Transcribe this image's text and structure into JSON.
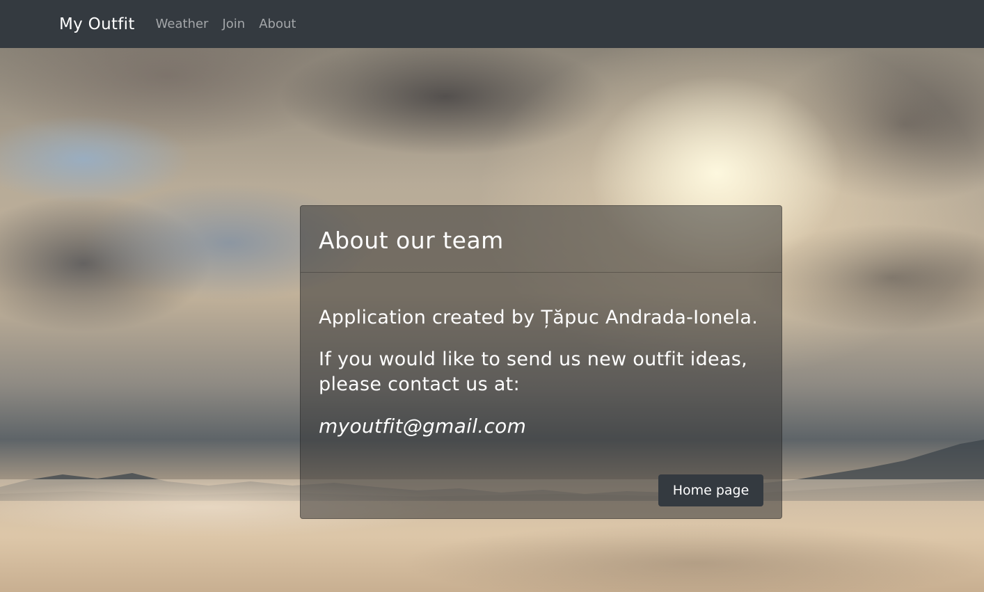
{
  "navbar": {
    "brand": "My Outfit",
    "links": [
      "Weather",
      "Join",
      "About"
    ]
  },
  "card": {
    "title": "About our team",
    "paragraph1": "Application created by Țăpuc Andrada-Ionela.",
    "paragraph2": "If you would like to send us new outfit ideas, please contact us at:",
    "email": "myoutfit@gmail.com",
    "button_label": "Home page"
  },
  "colors": {
    "navbar_bg": "#343a40",
    "button_bg": "#343a40",
    "text": "#ffffff"
  }
}
